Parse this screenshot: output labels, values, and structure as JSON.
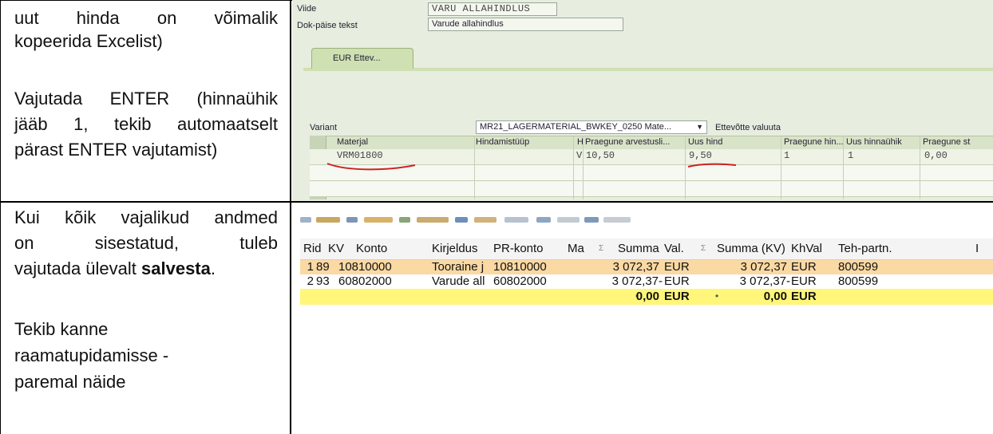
{
  "doc": {
    "cell1_lines": [
      "uut hinda on võimalik",
      "kopeerida Excelist)",
      "",
      "Vajutada ENTER (hinnaühik",
      "jääb 1, tekib automaatselt",
      "pärast ENTER vajutamist)"
    ],
    "cell2_lines": [
      "Kui kõik vajalikud andmed",
      "on sisestatud, tuleb",
      "vajutada ülevalt",
      "salvesta",
      ".",
      "Tekib kanne",
      "raamatupidamisse -",
      "paremal näide"
    ]
  },
  "sap_screen1": {
    "fields": {
      "viide_label": "Viide",
      "viide_value": "VARU ALLAHINDLUS",
      "dok_label": "Dok-päise tekst",
      "dok_value": "Varude allahindlus"
    },
    "tab_label": "EUR Ettev...",
    "variant_label": "Variant",
    "variant_value": "MR21_LAGERMATERIAL_BWKEY_0250 Mate...",
    "currency_label": "Ettevõtte valuuta",
    "columns": [
      "Materjal",
      "Hindamistüüp",
      "H",
      "Praegune arvestusli...",
      "Uus hind",
      "Praegune hin...",
      "Uus hinnaühik",
      "Praegune st"
    ],
    "row": {
      "material": "VRM01800",
      "h": "V",
      "current_price": "10,50",
      "new_price": "9,50",
      "current_unit": "1",
      "new_unit": "1",
      "current_std": "0,00"
    }
  },
  "sap_screen2": {
    "columns": [
      "Rid",
      "KV",
      "Konto",
      "Kirjeldus",
      "PR-konto",
      "Ma",
      "Summa",
      "Val.",
      "Summa (KV)",
      "KhVal",
      "Teh-partn."
    ],
    "rows": [
      [
        "1",
        "89",
        "10810000",
        "Tooraine j",
        "10810000",
        "",
        "3 072,37",
        "EUR",
        "3 072,37",
        "EUR",
        "800599"
      ],
      [
        "2",
        "93",
        "60802000",
        "Varude all",
        "60802000",
        "",
        "3 072,37-",
        "EUR",
        "3 072,37-",
        "EUR",
        "800599"
      ]
    ],
    "total": {
      "amount": "0,00",
      "currency": "EUR",
      "amount_kv": "0,00",
      "currency_kv": "EUR"
    }
  },
  "colors": {
    "row_highlight": "#fbd9a3",
    "total_row": "#fff67a",
    "sap_background": "#e7eddf",
    "annotation_red": "#cc2222"
  }
}
